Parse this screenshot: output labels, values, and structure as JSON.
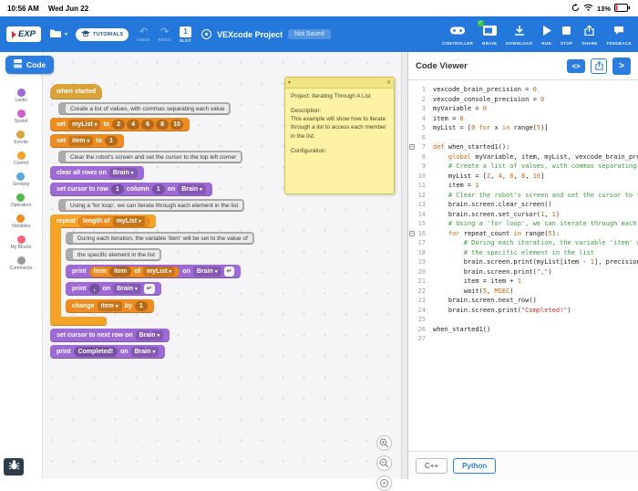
{
  "status_bar": {
    "time": "10:56 AM",
    "date": "Wed Jun 22",
    "battery": "13%"
  },
  "toolbar": {
    "logo_text": "EXP",
    "tutorials_label": "TUTORIALS",
    "undo_label": "UNDO",
    "redo_label": "REDO",
    "slot_number": "1",
    "slot_label": "SLOT",
    "project_name": "VEXcode Project",
    "save_status": "Not Saved",
    "controller_label": "CONTROLLER",
    "brain_label": "BRAIN",
    "download_label": "DOWNLOAD",
    "run_label": "RUN",
    "stop_label": "STOP",
    "share_label": "SHARE",
    "feedback_label": "FEEDBACK"
  },
  "code_tab": {
    "label": "Code"
  },
  "palette": {
    "items": [
      {
        "label": "Looks",
        "color": "#9c6bd8"
      },
      {
        "label": "Sound",
        "color": "#d05cd0"
      },
      {
        "label": "Events",
        "color": "#d9a43a"
      },
      {
        "label": "Control",
        "color": "#f5a327"
      },
      {
        "label": "Sensing",
        "color": "#58aadc"
      },
      {
        "label": "Operators",
        "color": "#54b84f"
      },
      {
        "label": "Variables",
        "color": "#ee8c22"
      },
      {
        "label": "My Blocks",
        "color": "#f6637e"
      },
      {
        "label": "Comments",
        "color": "#9a9a9a"
      }
    ]
  },
  "workspace": {
    "when_started": "when started",
    "comment_create": "Create a list of values, with commas separating each value",
    "set_mylist": {
      "set": "set",
      "var": "myList",
      "to": "to",
      "values": [
        "2",
        "4",
        "6",
        "8",
        "10"
      ]
    },
    "set_item": {
      "set": "set",
      "var": "item",
      "to": "to",
      "value": "1"
    },
    "comment_clear": "Clear the robot's screen and set the cursor to the top left corner",
    "clear_rows": {
      "label": "clear all rows on",
      "target": "Brain"
    },
    "set_cursor": {
      "prefix": "set cursor to row",
      "row": "1",
      "mid": "column",
      "col": "1",
      "on": "on",
      "target": "Brain"
    },
    "comment_loop": "Using a 'for loop', we can iterate through each element in the list",
    "repeat": {
      "label": "repeat",
      "length_of": "length of",
      "var": "myList"
    },
    "comment_iter1": "During each iteration, the variable 'item' will be set to the value of",
    "comment_iter2": "the specific element in the list",
    "print_item": {
      "print": "print",
      "item_label": "item",
      "item_var": "item",
      "of": "of",
      "list_var": "myList",
      "on": "on",
      "target": "Brain"
    },
    "print_comma": {
      "print": "print",
      "value": ",",
      "on": "on",
      "target": "Brain"
    },
    "change_item": {
      "change": "change",
      "var": "item",
      "by": "by",
      "value": "1"
    },
    "next_row": {
      "label": "set cursor to next row on",
      "target": "Brain"
    },
    "print_done": {
      "print": "print",
      "value": "Completed!",
      "on": "on",
      "target": "Brain"
    }
  },
  "note": {
    "title": "Project: Iterating Through A List",
    "description_label": "Description:",
    "description_text": "This example will show how to iterate through a list to access each member in the list.",
    "configuration_label": "Configuration:"
  },
  "code_viewer": {
    "title": "Code Viewer",
    "code_button": "<>",
    "expand_button": ">",
    "fold_lines": [
      7,
      16
    ],
    "lines": [
      "vexcode_brain_precision = 0",
      "vexcode_console_precision = 0",
      "myVariable = 0",
      "item = 0",
      "myList = [0 for x in range(5)]",
      "",
      "def when_started1():",
      "    global myVariable, item, myList, vexcode_brain_precision,",
      "    # Create a list of values, with commas separating each va",
      "    myList = [2, 4, 6, 8, 10]",
      "    item = 1",
      "    # Clear the robot's screen and set the cursor to the top",
      "    brain.screen.clear_screen()",
      "    brain.screen.set_cursor(1, 1)",
      "    # Using a 'for loop', we can iterate through each element",
      "    for repeat_count in range(5):",
      "        # During each iteration, the variable 'item' will be",
      "        # the specific element in the list",
      "        brain.screen.print(myList[item - 1], precision=0 if v",
      "        brain.screen.print(\",\")",
      "        item = item + 1",
      "        wait(5, MSEC)",
      "    brain.screen.next_row()",
      "    brain.screen.print(\"Completed!\")",
      "",
      "when_started1()",
      ""
    ],
    "tabs": {
      "cpp": "C++",
      "python": "Python"
    }
  },
  "icons": {
    "caret": "▾",
    "collapse": "▾",
    "close": "✕",
    "return": "↵"
  }
}
